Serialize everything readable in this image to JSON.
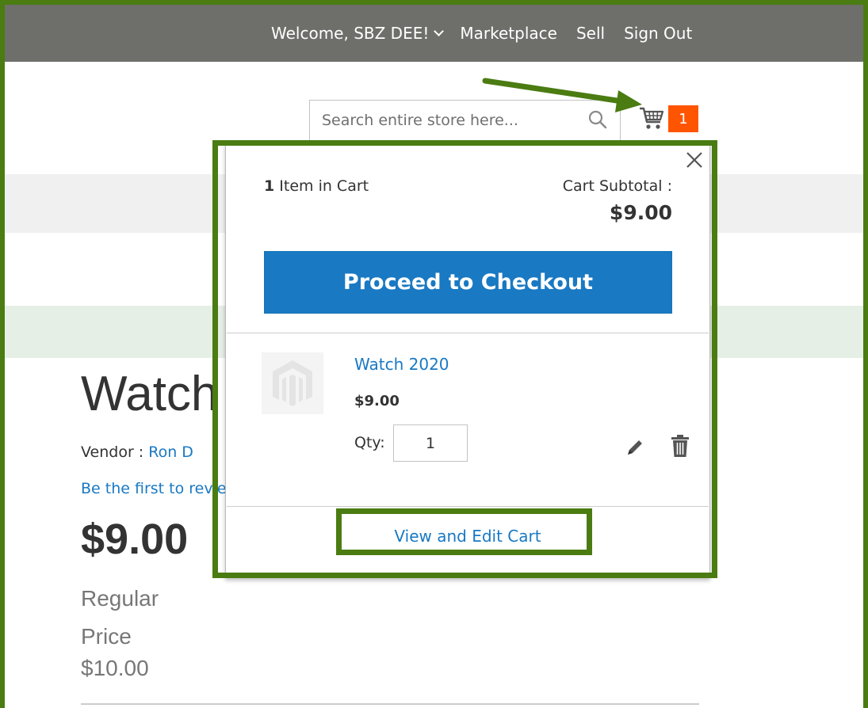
{
  "header": {
    "welcome": "Welcome, SBZ DEE!",
    "links": [
      "Marketplace",
      "Sell",
      "Sign Out"
    ]
  },
  "search": {
    "placeholder": "Search entire store here...",
    "value": ""
  },
  "cart": {
    "count": "1"
  },
  "minicart": {
    "items_count": "1",
    "items_label": " Item in Cart",
    "subtotal_label": "Cart Subtotal :",
    "subtotal_value": "$9.00",
    "checkout_label": "Proceed to Checkout",
    "item": {
      "name": "Watch 2020",
      "price": "$9.00",
      "qty_label": "Qty:",
      "qty_value": "1"
    },
    "view_edit_label": "View and Edit Cart"
  },
  "product": {
    "title": "Watch",
    "vendor_label": "Vendor : ",
    "vendor_name": "Ron D",
    "review_link": "Be the first to review this product",
    "price": "$9.00",
    "regular_label": "Regular Price",
    "regular_price": "$10.00"
  },
  "colors": {
    "annotation_green": "#4a7c12",
    "topbar": "#6e6e6b",
    "primary_blue": "#1979c3",
    "badge_orange": "#ff5501"
  }
}
